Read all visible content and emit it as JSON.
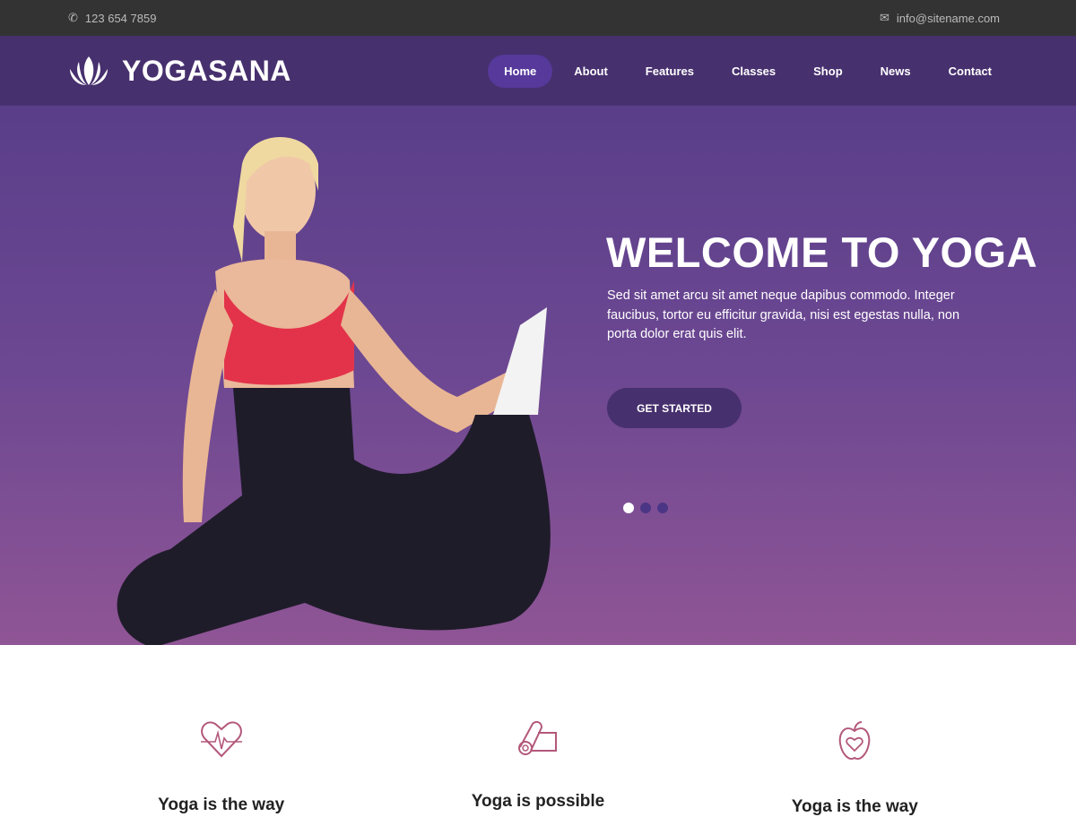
{
  "topbar": {
    "phone": "123 654 7859",
    "email": "info@sitename.com"
  },
  "brand": {
    "name": "YOGASANA"
  },
  "nav": {
    "items": [
      "Home",
      "About",
      "Features",
      "Classes",
      "Shop",
      "News",
      "Contact"
    ],
    "active": "Home"
  },
  "hero": {
    "title": "WELCOME TO YOGA",
    "text": "Sed sit amet arcu sit amet neque dapibus commodo. Integer faucibus, tortor eu efficitur gravida, nisi est egestas nulla, non porta dolor erat quis elit.",
    "button": "GET STARTED",
    "slides": 3,
    "active_slide": 1
  },
  "features": [
    {
      "icon": "heartbeat-icon",
      "title": "Yoga is the way"
    },
    {
      "icon": "yoga-mat-icon",
      "title": "Yoga is possible"
    },
    {
      "icon": "apple-heart-icon",
      "title": "Yoga is the way"
    }
  ],
  "colors": {
    "primary": "#47306e",
    "accent": "#b3587a"
  }
}
